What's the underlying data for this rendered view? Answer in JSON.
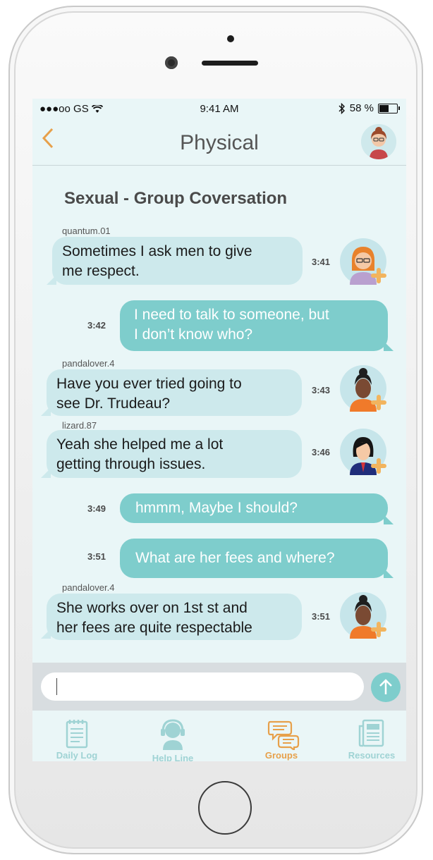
{
  "status": {
    "carrier": "●●●oo GS",
    "time": "9:41 AM",
    "battery": "58 %",
    "battery_level": 0.58
  },
  "nav": {
    "back_label": "<",
    "title": "Physical"
  },
  "conversation_title": "Sexual - Group Coversation",
  "messages": [
    {
      "user": "quantum.01",
      "text_line1": "Sometimes I ask men to give",
      "text_line2": "me respect.",
      "time": "3:41",
      "direction": "in"
    },
    {
      "text_line1": "I need to talk to someone, but",
      "text_line2": "I don’t know who?",
      "time": "3:42",
      "direction": "out"
    },
    {
      "user": "pandalover.4",
      "text_line1": "Have you ever tried going to",
      "text_line2": "see Dr. Trudeau?",
      "time": "3:43",
      "direction": "in"
    },
    {
      "user": "lizard.87",
      "text_line1": "Yeah she helped me a lot",
      "text_line2": "getting through issues.",
      "time": "3:46",
      "direction": "in"
    },
    {
      "text_line1": "hmmm, Maybe I should?",
      "time": "3:49",
      "direction": "out"
    },
    {
      "text_line1": "What are her fees and where?",
      "time": "3:51",
      "direction": "out"
    },
    {
      "user": "pandalover.4",
      "text_line1": "She works over on 1st st and",
      "text_line2": "her fees are quite respectable",
      "time": "3:51",
      "direction": "in"
    }
  ],
  "input": {
    "placeholder": "",
    "value": ""
  },
  "tabs": [
    {
      "label": "Daily Log",
      "icon": "notepad-icon",
      "active": false
    },
    {
      "label": "Help Line",
      "icon": "headset-icon",
      "active": false
    },
    {
      "label": "Groups",
      "icon": "chat-bubbles-icon",
      "active": true
    },
    {
      "label": "Resources",
      "icon": "newspaper-icon",
      "active": false
    }
  ],
  "colors": {
    "accent": "#e7a04a",
    "teal": "#7ecdcc",
    "bubble_in": "#cde9ec",
    "screen_bg": "#e9f6f7"
  }
}
